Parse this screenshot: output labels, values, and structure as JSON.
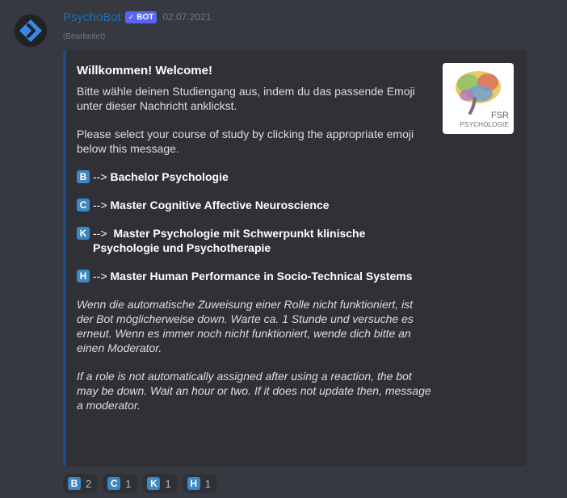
{
  "message": {
    "author": "PsychoBot",
    "bot_tag": "BOT",
    "bot_check": "✓",
    "timestamp": "02.07.2021",
    "edited": "(Bearbeitet)"
  },
  "embed": {
    "title": "Willkommen! Welcome!",
    "intro_de": "Bitte wähle deinen Studiengang aus, indem du das passende Emoji unter dieser Nachricht anklickst.",
    "intro_en": "Please select your course of study by clicking the appropriate emoji below this message.",
    "courses": [
      {
        "letter": "B",
        "arrow": "-->",
        "name": "Bachelor Psychologie"
      },
      {
        "letter": "C",
        "arrow": "-->",
        "name": "Master Cognitive Affective Neuroscience"
      },
      {
        "letter": "K",
        "arrow": "-->",
        "name": "Master Psychologie mit Schwerpunkt klinische Psychologie und Psychotherapie"
      },
      {
        "letter": "H",
        "arrow": "-->",
        "name": "Master Human Performance in Socio-Technical Systems"
      }
    ],
    "note_de": "Wenn die automatische Zuweisung einer Rolle nicht funktioniert, ist der Bot möglicherweise down. Warte ca. 1 Stunde und versuche es erneut. Wenn es immer noch nicht funktioniert, wende dich bitte an einen Moderator.",
    "note_en": "If a role is not automatically assigned after using a reaction, the bot may be down. Wait an hour or two. If it does not update then, message a moderator.",
    "thumbnail": {
      "line1": "FSR",
      "line2": "PSYCHOLOGIE"
    },
    "accent_color": "#1d4e8a"
  },
  "reactions": [
    {
      "letter": "B",
      "count": "2"
    },
    {
      "letter": "C",
      "count": "1"
    },
    {
      "letter": "K",
      "count": "1"
    },
    {
      "letter": "H",
      "count": "1"
    }
  ],
  "colors": {
    "background": "#36393f",
    "embed_background": "#2f3136",
    "username": "#1d6fb8",
    "bot_tag": "#5865f2",
    "letter_emoji": "#3b88c3"
  }
}
